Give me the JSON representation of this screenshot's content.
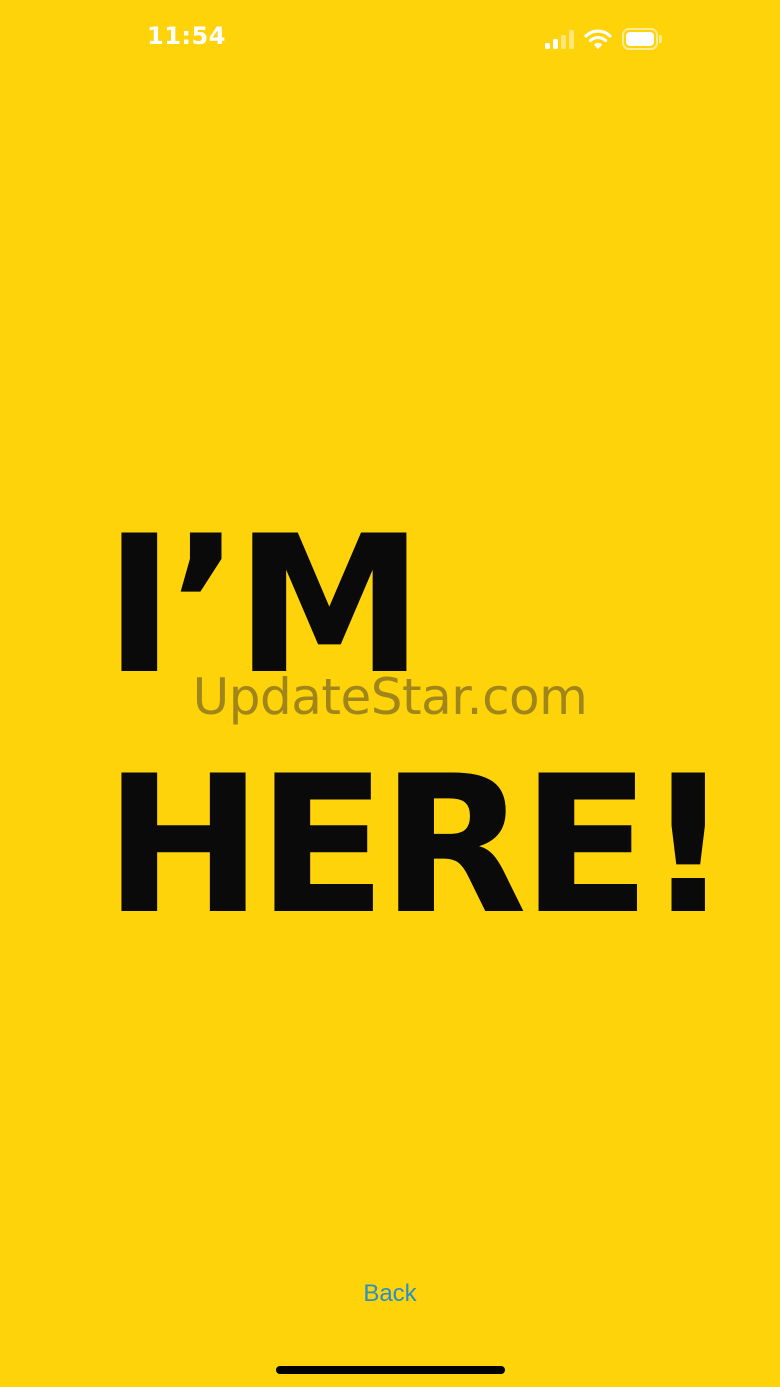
{
  "status_bar": {
    "time": "11:54",
    "signal_icon": "cellular-signal-icon",
    "wifi_icon": "wifi-icon",
    "battery_icon": "battery-icon",
    "battery_level": 1.0
  },
  "screen": {
    "headline_line_1": "I’M",
    "headline_line_2": "HERE!",
    "background_color": "#FED30A",
    "text_color": "#0A0A0A"
  },
  "watermark": {
    "text": "UpdateStar.com"
  },
  "navigation": {
    "back_label": "Back",
    "link_color": "#2B8FC7"
  }
}
